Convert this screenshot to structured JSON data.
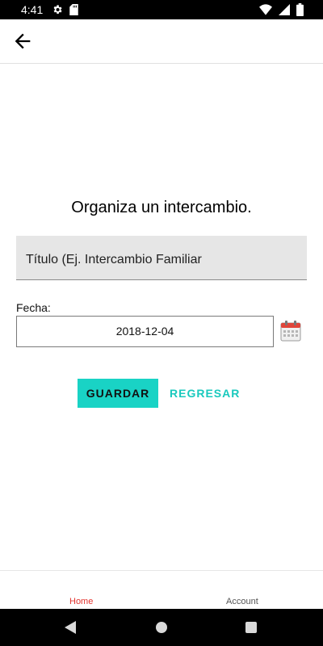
{
  "status_bar": {
    "time": "4:41",
    "icons_left": [
      "gear-icon",
      "sd-card-icon"
    ],
    "icons_right": [
      "wifi-icon",
      "signal-icon",
      "battery-icon"
    ]
  },
  "app_bar": {
    "back_icon": "arrow-back-icon"
  },
  "form": {
    "heading": "Organiza un intercambio.",
    "title_placeholder": "Título (Ej. Intercambio Familiar",
    "date_label": "Fecha:",
    "date_value": "2018-12-04",
    "calendar_icon": "calendar-icon"
  },
  "actions": {
    "save_label": "GUARDAR",
    "back_label": "REGRESAR"
  },
  "bottom_nav": {
    "home_label": "Home",
    "account_label": "Account",
    "active": "Home"
  },
  "colors": {
    "accent": "#19d3c5",
    "active_tab": "#e3342f",
    "field_bg": "#e6e6e6"
  }
}
